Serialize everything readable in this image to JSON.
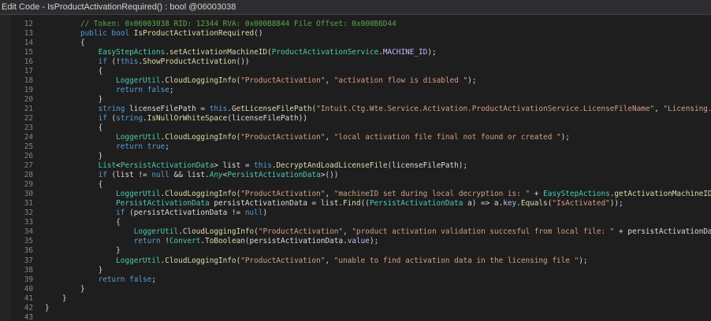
{
  "window": {
    "title": "Edit Code - IsProductActivationRequired() : bool @06003038"
  },
  "editor": {
    "lines": [
      {
        "num": "12",
        "tokens": [
          {
            "c": "c",
            "t": "// Token: 0x06003038 RID: 12344 RVA: 0x000B8844 File Offset: 0x000B6D44"
          }
        ]
      },
      {
        "num": "13",
        "tokens": [
          {
            "c": "k",
            "t": "public"
          },
          {
            "c": "p",
            "t": " "
          },
          {
            "c": "k",
            "t": "bool"
          },
          {
            "c": "p",
            "t": " "
          },
          {
            "c": "m",
            "t": "IsProductActivationRequired"
          },
          {
            "c": "p",
            "t": "()"
          }
        ]
      },
      {
        "num": "14",
        "tokens": [
          {
            "c": "p",
            "t": "{"
          }
        ]
      },
      {
        "num": "15",
        "tokens": [
          {
            "c": "p",
            "t": "    "
          },
          {
            "c": "t",
            "t": "EasyStepActions"
          },
          {
            "c": "p",
            "t": "."
          },
          {
            "c": "m",
            "t": "setActivationMachineID"
          },
          {
            "c": "p",
            "t": "("
          },
          {
            "c": "t",
            "t": "ProductActivationService"
          },
          {
            "c": "p",
            "t": "."
          },
          {
            "c": "f",
            "t": "MACHINE_ID"
          },
          {
            "c": "p",
            "t": ");"
          }
        ]
      },
      {
        "num": "16",
        "tokens": [
          {
            "c": "p",
            "t": "    "
          },
          {
            "c": "k",
            "t": "if"
          },
          {
            "c": "p",
            "t": " (!"
          },
          {
            "c": "k",
            "t": "this"
          },
          {
            "c": "p",
            "t": "."
          },
          {
            "c": "m",
            "t": "ShowProductActivation"
          },
          {
            "c": "p",
            "t": "())"
          }
        ]
      },
      {
        "num": "17",
        "tokens": [
          {
            "c": "p",
            "t": "    {"
          }
        ]
      },
      {
        "num": "18",
        "tokens": [
          {
            "c": "p",
            "t": "        "
          },
          {
            "c": "t",
            "t": "LoggerUtil"
          },
          {
            "c": "p",
            "t": "."
          },
          {
            "c": "m",
            "t": "CloudLoggingInfo"
          },
          {
            "c": "p",
            "t": "("
          },
          {
            "c": "s",
            "t": "\"ProductActivation\""
          },
          {
            "c": "p",
            "t": ", "
          },
          {
            "c": "s",
            "t": "\"activation flow is disabled \""
          },
          {
            "c": "p",
            "t": ");"
          }
        ]
      },
      {
        "num": "19",
        "tokens": [
          {
            "c": "p",
            "t": "        "
          },
          {
            "c": "k",
            "t": "return"
          },
          {
            "c": "p",
            "t": " "
          },
          {
            "c": "k",
            "t": "false"
          },
          {
            "c": "p",
            "t": ";"
          }
        ]
      },
      {
        "num": "20",
        "tokens": [
          {
            "c": "p",
            "t": "    }"
          }
        ]
      },
      {
        "num": "21",
        "tokens": [
          {
            "c": "p",
            "t": "    "
          },
          {
            "c": "k",
            "t": "string"
          },
          {
            "c": "p",
            "t": " licenseFilePath = "
          },
          {
            "c": "k",
            "t": "this"
          },
          {
            "c": "p",
            "t": "."
          },
          {
            "c": "m",
            "t": "GetLicenseFilePath"
          },
          {
            "c": "p",
            "t": "("
          },
          {
            "c": "s",
            "t": "\"Intuit.Ctg.Wte.Service.Activation.ProductActivationService.LicenseFileName\""
          },
          {
            "c": "p",
            "t": ", "
          },
          {
            "c": "s",
            "t": "\"Licensing.p"
          }
        ]
      },
      {
        "num": "22",
        "tokens": [
          {
            "c": "p",
            "t": "    "
          },
          {
            "c": "k",
            "t": "if"
          },
          {
            "c": "p",
            "t": " ("
          },
          {
            "c": "k",
            "t": "string"
          },
          {
            "c": "p",
            "t": "."
          },
          {
            "c": "m",
            "t": "IsNullOrWhiteSpace"
          },
          {
            "c": "p",
            "t": "(licenseFilePath))"
          }
        ]
      },
      {
        "num": "23",
        "tokens": [
          {
            "c": "p",
            "t": "    {"
          }
        ]
      },
      {
        "num": "24",
        "tokens": [
          {
            "c": "p",
            "t": "        "
          },
          {
            "c": "t",
            "t": "LoggerUtil"
          },
          {
            "c": "p",
            "t": "."
          },
          {
            "c": "m",
            "t": "CloudLoggingInfo"
          },
          {
            "c": "p",
            "t": "("
          },
          {
            "c": "s",
            "t": "\"ProductActivation\""
          },
          {
            "c": "p",
            "t": ", "
          },
          {
            "c": "s",
            "t": "\"local activation file final not found or created \""
          },
          {
            "c": "p",
            "t": ");"
          }
        ]
      },
      {
        "num": "25",
        "tokens": [
          {
            "c": "p",
            "t": "        "
          },
          {
            "c": "k",
            "t": "return"
          },
          {
            "c": "p",
            "t": " "
          },
          {
            "c": "k",
            "t": "true"
          },
          {
            "c": "p",
            "t": ";"
          }
        ]
      },
      {
        "num": "26",
        "tokens": [
          {
            "c": "p",
            "t": "    }"
          }
        ]
      },
      {
        "num": "27",
        "tokens": [
          {
            "c": "p",
            "t": "    "
          },
          {
            "c": "t",
            "t": "List"
          },
          {
            "c": "p",
            "t": "<"
          },
          {
            "c": "t",
            "t": "PersistActivationData"
          },
          {
            "c": "p",
            "t": "> list = "
          },
          {
            "c": "k",
            "t": "this"
          },
          {
            "c": "p",
            "t": "."
          },
          {
            "c": "m",
            "t": "DecryptAndLoadLicenseFile"
          },
          {
            "c": "p",
            "t": "(licenseFilePath);"
          }
        ]
      },
      {
        "num": "28",
        "tokens": [
          {
            "c": "p",
            "t": "    "
          },
          {
            "c": "k",
            "t": "if"
          },
          {
            "c": "p",
            "t": " (list != "
          },
          {
            "c": "k",
            "t": "null"
          },
          {
            "c": "p",
            "t": " && list."
          },
          {
            "c": "tk",
            "t": "Any"
          },
          {
            "c": "p",
            "t": "<"
          },
          {
            "c": "t",
            "t": "PersistActivationData"
          },
          {
            "c": "p",
            "t": ">())"
          }
        ]
      },
      {
        "num": "29",
        "tokens": [
          {
            "c": "p",
            "t": "    {"
          }
        ]
      },
      {
        "num": "30",
        "tokens": [
          {
            "c": "p",
            "t": "        "
          },
          {
            "c": "t",
            "t": "LoggerUtil"
          },
          {
            "c": "p",
            "t": "."
          },
          {
            "c": "m",
            "t": "CloudLoggingInfo"
          },
          {
            "c": "p",
            "t": "("
          },
          {
            "c": "s",
            "t": "\"ProductActivation\""
          },
          {
            "c": "p",
            "t": ", "
          },
          {
            "c": "s",
            "t": "\"machineID set during local decryption is: \""
          },
          {
            "c": "p",
            "t": " + "
          },
          {
            "c": "t",
            "t": "EasyStepActions"
          },
          {
            "c": "p",
            "t": "."
          },
          {
            "c": "m",
            "t": "getActivationMachineID"
          },
          {
            "c": "p",
            "t": "("
          }
        ]
      },
      {
        "num": "31",
        "tokens": [
          {
            "c": "p",
            "t": "        "
          },
          {
            "c": "t",
            "t": "PersistActivationData"
          },
          {
            "c": "p",
            "t": " persistActivationData = list."
          },
          {
            "c": "m",
            "t": "Find"
          },
          {
            "c": "p",
            "t": "(("
          },
          {
            "c": "t",
            "t": "PersistActivationData"
          },
          {
            "c": "p",
            "t": " a) => a."
          },
          {
            "c": "f",
            "t": "key"
          },
          {
            "c": "p",
            "t": "."
          },
          {
            "c": "m",
            "t": "Equals"
          },
          {
            "c": "p",
            "t": "("
          },
          {
            "c": "s",
            "t": "\"IsActivated\""
          },
          {
            "c": "p",
            "t": "));"
          }
        ]
      },
      {
        "num": "32",
        "tokens": [
          {
            "c": "p",
            "t": "        "
          },
          {
            "c": "k",
            "t": "if"
          },
          {
            "c": "p",
            "t": " (persistActivationData != "
          },
          {
            "c": "k",
            "t": "null"
          },
          {
            "c": "p",
            "t": ")"
          }
        ]
      },
      {
        "num": "33",
        "tokens": [
          {
            "c": "p",
            "t": "        {"
          }
        ]
      },
      {
        "num": "34",
        "tokens": [
          {
            "c": "p",
            "t": "            "
          },
          {
            "c": "t",
            "t": "LoggerUtil"
          },
          {
            "c": "p",
            "t": "."
          },
          {
            "c": "m",
            "t": "CloudLoggingInfo"
          },
          {
            "c": "p",
            "t": "("
          },
          {
            "c": "s",
            "t": "\"ProductActivation\""
          },
          {
            "c": "p",
            "t": ", "
          },
          {
            "c": "s",
            "t": "\"product activation validation succesful from local file: \""
          },
          {
            "c": "p",
            "t": " + persistActivationDat"
          }
        ]
      },
      {
        "num": "35",
        "tokens": [
          {
            "c": "p",
            "t": "            "
          },
          {
            "c": "k",
            "t": "return"
          },
          {
            "c": "p",
            "t": " !"
          },
          {
            "c": "t",
            "t": "Convert"
          },
          {
            "c": "p",
            "t": "."
          },
          {
            "c": "m",
            "t": "ToBoolean"
          },
          {
            "c": "p",
            "t": "(persistActivationData."
          },
          {
            "c": "f",
            "t": "value"
          },
          {
            "c": "p",
            "t": ");"
          }
        ]
      },
      {
        "num": "36",
        "tokens": [
          {
            "c": "p",
            "t": "        }"
          }
        ]
      },
      {
        "num": "37",
        "tokens": [
          {
            "c": "p",
            "t": "        "
          },
          {
            "c": "t",
            "t": "LoggerUtil"
          },
          {
            "c": "p",
            "t": "."
          },
          {
            "c": "m",
            "t": "CloudLoggingInfo"
          },
          {
            "c": "p",
            "t": "("
          },
          {
            "c": "s",
            "t": "\"ProductActivation\""
          },
          {
            "c": "p",
            "t": ", "
          },
          {
            "c": "s",
            "t": "\"unable to find activation data in the licensing file \""
          },
          {
            "c": "p",
            "t": ");"
          }
        ]
      },
      {
        "num": "38",
        "tokens": [
          {
            "c": "p",
            "t": "    }"
          }
        ]
      },
      {
        "num": "39",
        "tokens": [
          {
            "c": "p",
            "t": "    "
          },
          {
            "c": "k",
            "t": "return"
          },
          {
            "c": "p",
            "t": " "
          },
          {
            "c": "k",
            "t": "false"
          },
          {
            "c": "p",
            "t": ";"
          }
        ]
      },
      {
        "num": "40",
        "tokens": [
          {
            "c": "p",
            "t": "}"
          }
        ]
      },
      {
        "num": "41",
        "tokens": [
          {
            "c": "p",
            "t": "}"
          }
        ],
        "indent": "outer1"
      },
      {
        "num": "42",
        "tokens": [
          {
            "c": "p",
            "t": "}"
          }
        ],
        "indent": "outer2"
      },
      {
        "num": "43",
        "tokens": []
      }
    ]
  }
}
